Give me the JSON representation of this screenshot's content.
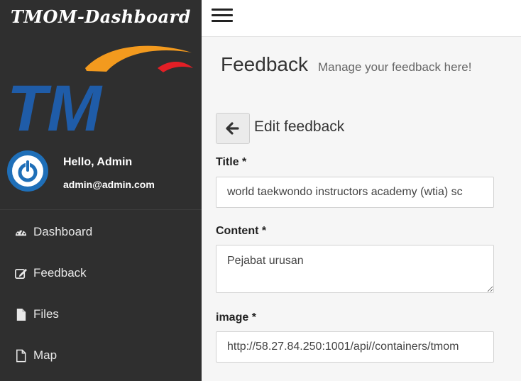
{
  "app": {
    "brand": "TMOM-Dashboard",
    "logo_text": "TM"
  },
  "profile": {
    "greeting": "Hello, Admin",
    "email": "admin@admin.com"
  },
  "sidebar": {
    "items": [
      {
        "label": "Dashboard",
        "icon": "dashboard-icon"
      },
      {
        "label": "Feedback",
        "icon": "edit-icon"
      },
      {
        "label": "Files",
        "icon": "file-icon"
      },
      {
        "label": "Map",
        "icon": "file-outline-icon"
      }
    ]
  },
  "header": {
    "title": "Feedback",
    "subtitle": "Manage your feedback here!"
  },
  "form": {
    "heading": "Edit feedback",
    "title_label": "Title *",
    "title_value": "world taekwondo instructors academy (wtia) sc",
    "content_label": "Content *",
    "content_value": "Pejabat urusan",
    "image_label": "image *",
    "image_value": "http://58.27.84.250:1001/api//containers/tmom"
  },
  "colors": {
    "sidebar": "#2f2f2f",
    "accent_blue": "#1f5ca8",
    "accent_orange": "#f39a1e",
    "accent_red": "#e31f26"
  }
}
